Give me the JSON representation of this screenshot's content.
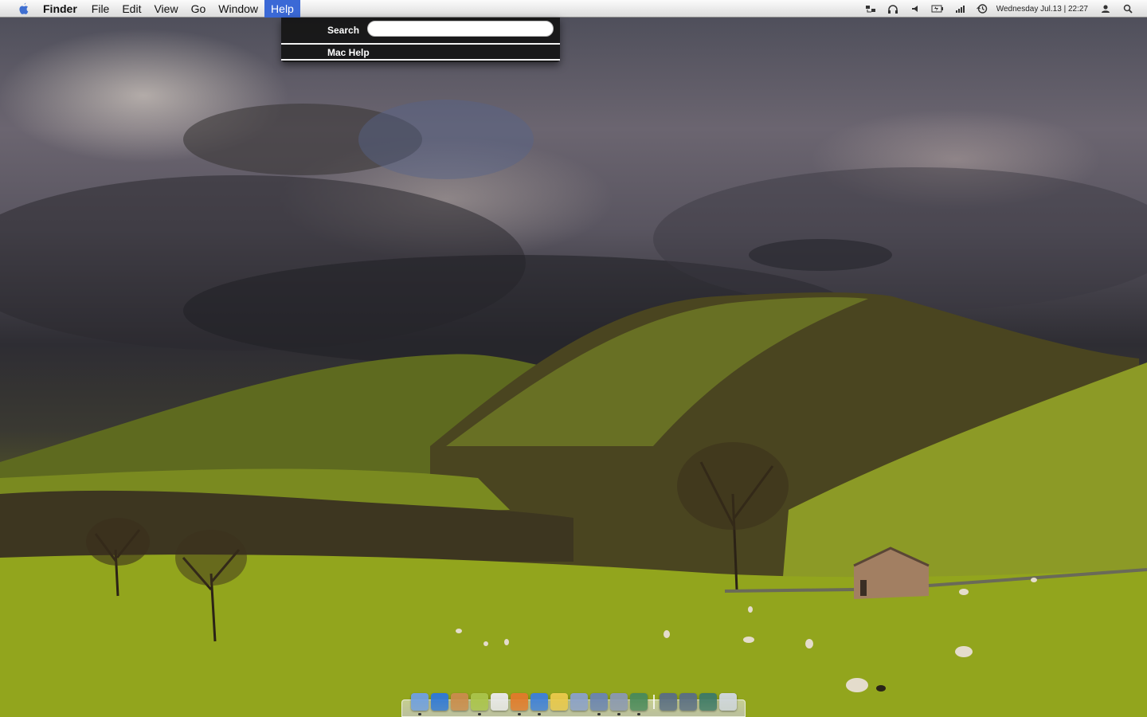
{
  "menubar": {
    "apple_icon": "apple-logo-icon",
    "app_name": "Finder",
    "menus": [
      "File",
      "Edit",
      "View",
      "Go",
      "Window",
      "Help"
    ],
    "active_menu": "Help",
    "status_icons": [
      "time-machine-icon",
      "headphones-icon",
      "volume-icon",
      "battery-icon",
      "wifi-signal-icon",
      "clock-history-icon"
    ],
    "clock": "Wednesday Jul.13 | 22:27",
    "user_icon": "user-icon",
    "spotlight_icon": "spotlight-search-icon"
  },
  "help_menu": {
    "search_label": "Search",
    "search_value": "",
    "items": [
      "Mac Help"
    ]
  },
  "dock": {
    "apps": [
      {
        "name": "finder-icon",
        "color": "#6f9fe0",
        "running": true
      },
      {
        "name": "app-store-icon",
        "color": "#2f78d6",
        "running": false
      },
      {
        "name": "preview-icon",
        "color": "#c98b4b",
        "running": false
      },
      {
        "name": "iphoto-icon",
        "color": "#a9c34a",
        "running": true
      },
      {
        "name": "calendar-icon",
        "color": "#e8e8e8",
        "running": false
      },
      {
        "name": "firefox-icon",
        "color": "#e07a2a",
        "running": true
      },
      {
        "name": "itunes-icon",
        "color": "#3d7fd8",
        "running": true
      },
      {
        "name": "adium-icon",
        "color": "#e8c84a",
        "running": false
      },
      {
        "name": "xcode-icon",
        "color": "#8aa0c8",
        "running": false
      },
      {
        "name": "pause-utility-icon",
        "color": "#6a84b0",
        "running": true
      },
      {
        "name": "system-preferences-icon",
        "color": "#8a98b0",
        "running": true
      },
      {
        "name": "activity-monitor-icon",
        "color": "#4a8a5a",
        "running": true
      }
    ],
    "stacks": [
      {
        "name": "applications-folder-icon",
        "color": "#5a6e82"
      },
      {
        "name": "documents-folder-icon",
        "color": "#5a6e82"
      },
      {
        "name": "downloads-folder-icon",
        "color": "#3e7a66"
      },
      {
        "name": "trash-icon",
        "color": "#cfd6dc"
      }
    ]
  }
}
